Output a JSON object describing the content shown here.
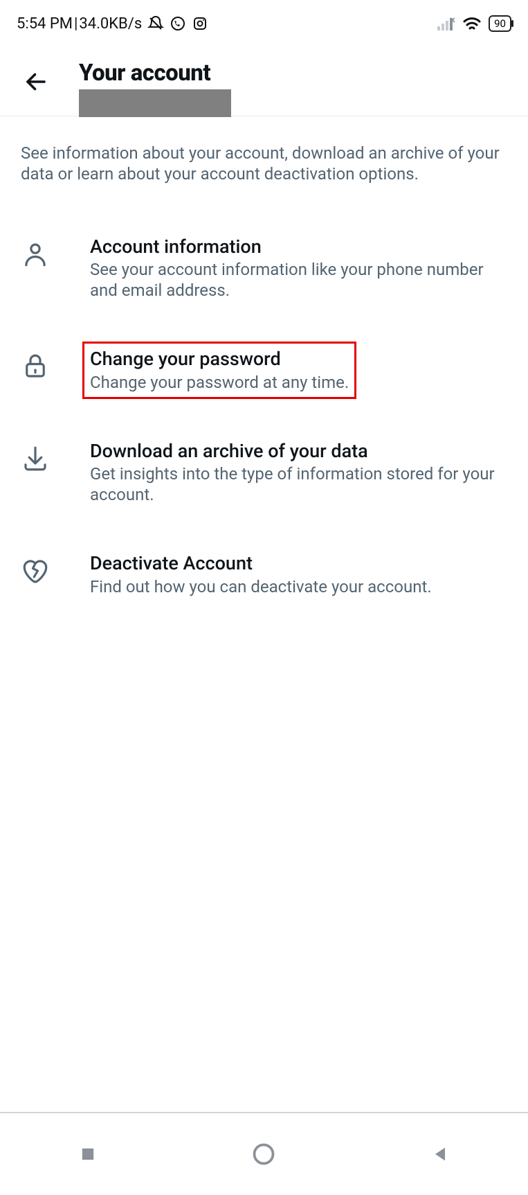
{
  "status_bar": {
    "time": "5:54 PM",
    "separator": " | ",
    "network_speed": "34.0KB/s",
    "battery_percent": "90"
  },
  "header": {
    "title": "Your account"
  },
  "description": "See information about your account, download an archive of your data or learn about your account deactivation options.",
  "items": [
    {
      "icon": "person-icon",
      "title": "Account information",
      "subtitle": "See your account information like your phone number and email address.",
      "highlighted": false
    },
    {
      "icon": "lock-icon",
      "title": "Change your password",
      "subtitle": "Change your password at any time.",
      "highlighted": true
    },
    {
      "icon": "download-icon",
      "title": "Download an archive of your data",
      "subtitle": "Get insights into the type of information stored for your account.",
      "highlighted": false
    },
    {
      "icon": "heart-broken-icon",
      "title": "Deactivate Account",
      "subtitle": "Find out how you can deactivate your account.",
      "highlighted": false
    }
  ]
}
